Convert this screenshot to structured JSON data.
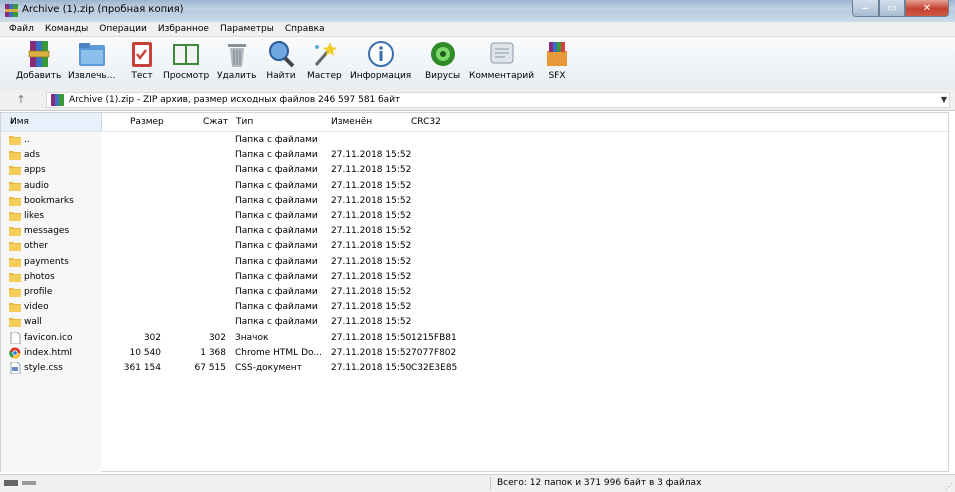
{
  "window": {
    "title": "Archive (1).zip (пробная копия)"
  },
  "menu": [
    "Файл",
    "Команды",
    "Операции",
    "Избранное",
    "Параметры",
    "Справка"
  ],
  "toolbar": [
    {
      "label": "Добавить",
      "icon": "archive-add-icon"
    },
    {
      "label": "Извлечь...",
      "icon": "folder-extract-icon"
    },
    {
      "label": "Тест",
      "icon": "test-clipboard-icon"
    },
    {
      "label": "Просмотр",
      "icon": "book-view-icon"
    },
    {
      "label": "Удалить",
      "icon": "trash-icon"
    },
    {
      "label": "Найти",
      "icon": "magnifier-icon"
    },
    {
      "label": "Мастер",
      "icon": "magic-wand-icon"
    },
    {
      "label": "Информация",
      "icon": "info-icon"
    },
    {
      "label": "Вирусы",
      "icon": "virus-scan-icon"
    },
    {
      "label": "Комментарий",
      "icon": "comment-icon"
    },
    {
      "label": "SFX",
      "icon": "sfx-box-icon"
    }
  ],
  "address": {
    "text": "Archive (1).zip - ZIP архив, размер исходных файлов 246 597 581 байт"
  },
  "columns": {
    "name": "Имя",
    "size": "Размер",
    "packed": "Сжат",
    "type": "Тип",
    "modified": "Изменён",
    "crc": "CRC32"
  },
  "files": [
    {
      "name": "..",
      "size": "",
      "packed": "",
      "type": "Папка с файлами",
      "modified": "",
      "crc": "",
      "icon": "folder-icon"
    },
    {
      "name": "ads",
      "size": "",
      "packed": "",
      "type": "Папка с файлами",
      "modified": "27.11.2018 15:52",
      "crc": "",
      "icon": "folder-icon"
    },
    {
      "name": "apps",
      "size": "",
      "packed": "",
      "type": "Папка с файлами",
      "modified": "27.11.2018 15:52",
      "crc": "",
      "icon": "folder-icon"
    },
    {
      "name": "audio",
      "size": "",
      "packed": "",
      "type": "Папка с файлами",
      "modified": "27.11.2018 15:52",
      "crc": "",
      "icon": "folder-icon"
    },
    {
      "name": "bookmarks",
      "size": "",
      "packed": "",
      "type": "Папка с файлами",
      "modified": "27.11.2018 15:52",
      "crc": "",
      "icon": "folder-icon"
    },
    {
      "name": "likes",
      "size": "",
      "packed": "",
      "type": "Папка с файлами",
      "modified": "27.11.2018 15:52",
      "crc": "",
      "icon": "folder-icon"
    },
    {
      "name": "messages",
      "size": "",
      "packed": "",
      "type": "Папка с файлами",
      "modified": "27.11.2018 15:52",
      "crc": "",
      "icon": "folder-icon"
    },
    {
      "name": "other",
      "size": "",
      "packed": "",
      "type": "Папка с файлами",
      "modified": "27.11.2018 15:52",
      "crc": "",
      "icon": "folder-icon"
    },
    {
      "name": "payments",
      "size": "",
      "packed": "",
      "type": "Папка с файлами",
      "modified": "27.11.2018 15:52",
      "crc": "",
      "icon": "folder-icon"
    },
    {
      "name": "photos",
      "size": "",
      "packed": "",
      "type": "Папка с файлами",
      "modified": "27.11.2018 15:52",
      "crc": "",
      "icon": "folder-icon"
    },
    {
      "name": "profile",
      "size": "",
      "packed": "",
      "type": "Папка с файлами",
      "modified": "27.11.2018 15:52",
      "crc": "",
      "icon": "folder-icon"
    },
    {
      "name": "video",
      "size": "",
      "packed": "",
      "type": "Папка с файлами",
      "modified": "27.11.2018 15:52",
      "crc": "",
      "icon": "folder-icon"
    },
    {
      "name": "wall",
      "size": "",
      "packed": "",
      "type": "Папка с файлами",
      "modified": "27.11.2018 15:52",
      "crc": "",
      "icon": "folder-icon"
    },
    {
      "name": "favicon.ico",
      "size": "302",
      "packed": "302",
      "type": "Значок",
      "modified": "27.11.2018 15:50",
      "crc": "1215FB81",
      "icon": "file-icon"
    },
    {
      "name": "index.html",
      "size": "10 540",
      "packed": "1 368",
      "type": "Chrome HTML Do...",
      "modified": "27.11.2018 15:52",
      "crc": "7077F802",
      "icon": "chrome-icon"
    },
    {
      "name": "style.css",
      "size": "361 154",
      "packed": "67 515",
      "type": "CSS-документ",
      "modified": "27.11.2018 15:50",
      "crc": "C32E3E85",
      "icon": "css-file-icon"
    }
  ],
  "status": {
    "text": "Всего: 12 папок и 371 996 байт в 3 файлах"
  },
  "colors": {
    "titlebar": "#b6c9de",
    "folder": "#e8b840",
    "header_selected": "#e7f0fb"
  }
}
